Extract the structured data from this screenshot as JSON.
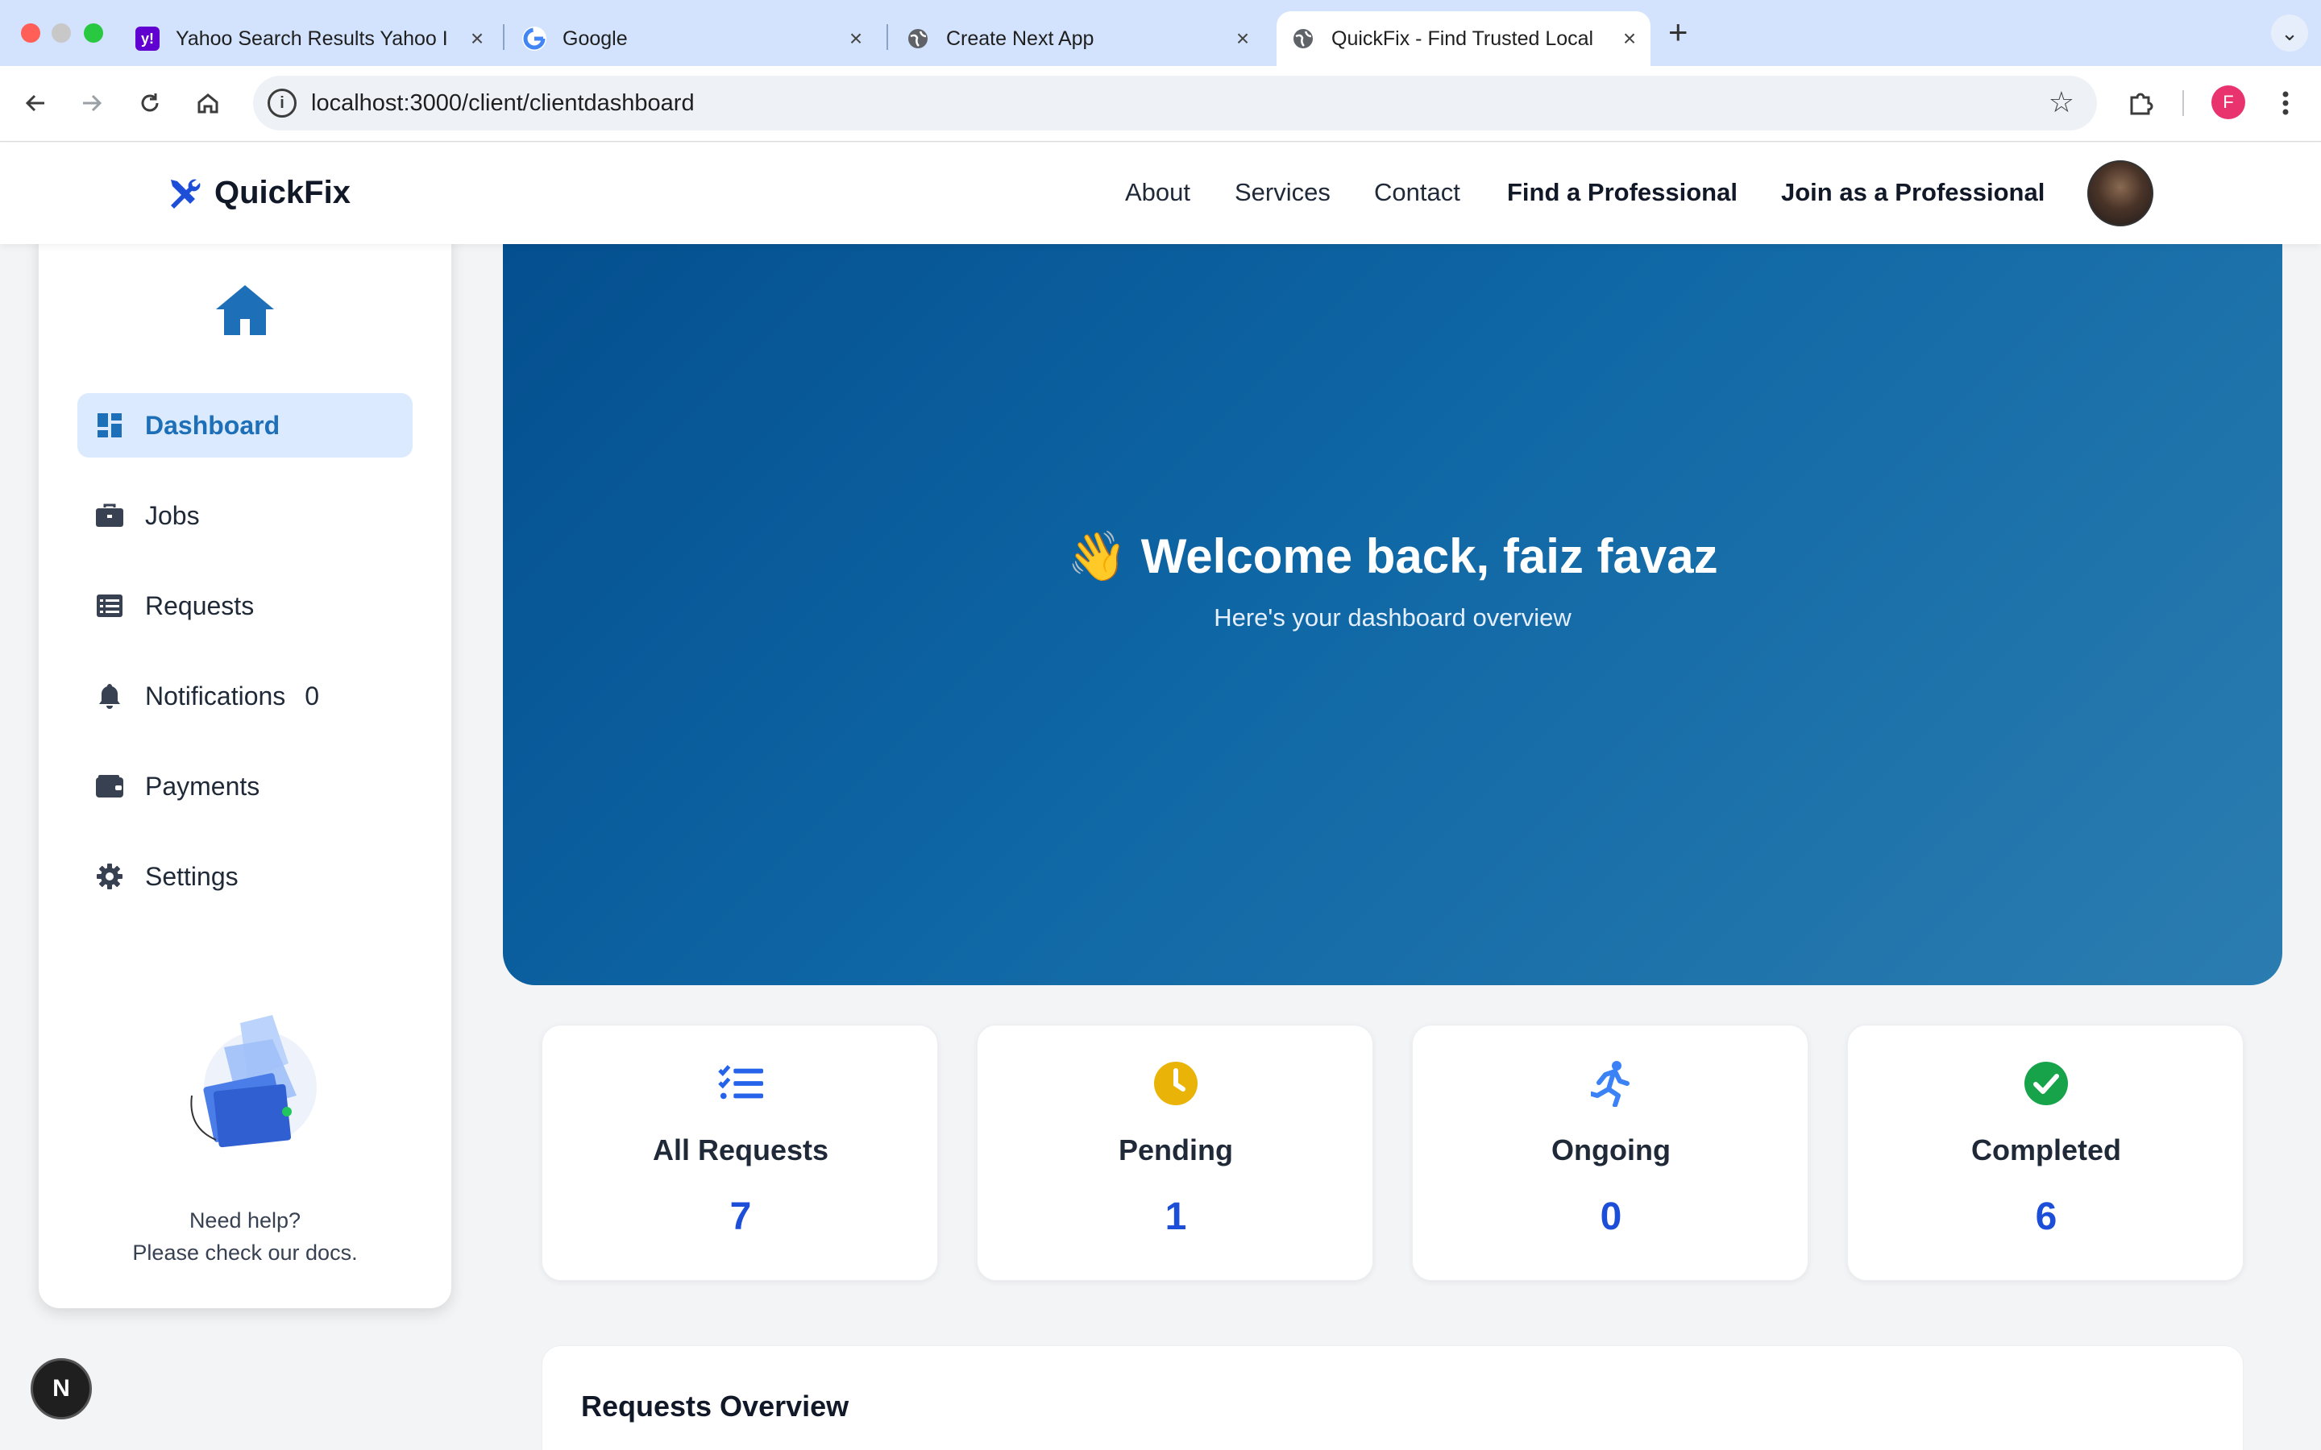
{
  "browser": {
    "tabs": [
      {
        "title": "Yahoo Search Results Yahoo I",
        "favicon": "yahoo-icon",
        "active": false
      },
      {
        "title": "Google",
        "favicon": "google-icon",
        "active": false
      },
      {
        "title": "Create Next App",
        "favicon": "globe-icon",
        "active": false
      },
      {
        "title": "QuickFix - Find Trusted Local",
        "favicon": "globe-icon",
        "active": true
      }
    ],
    "new_tab_label": "+",
    "url": "localhost:3000/client/clientdashboard",
    "profile_initial": "F"
  },
  "header": {
    "brand": "QuickFix",
    "nav": [
      {
        "label": "About",
        "strong": false
      },
      {
        "label": "Services",
        "strong": false
      },
      {
        "label": "Contact",
        "strong": false
      },
      {
        "label": "Find a Professional",
        "strong": true
      },
      {
        "label": "Join as a Professional",
        "strong": true
      }
    ]
  },
  "sidebar": {
    "items": [
      {
        "label": "Dashboard",
        "icon": "dashboard-icon",
        "active": true
      },
      {
        "label": "Jobs",
        "icon": "briefcase-icon",
        "active": false
      },
      {
        "label": "Requests",
        "icon": "list-icon",
        "active": false
      },
      {
        "label": "Notifications",
        "icon": "bell-icon",
        "active": false,
        "count": "0"
      },
      {
        "label": "Payments",
        "icon": "wallet-icon",
        "active": false
      },
      {
        "label": "Settings",
        "icon": "gear-icon",
        "active": false
      }
    ],
    "help_line1": "Need help?",
    "help_line2": "Please check our docs."
  },
  "hero": {
    "emoji": "👋",
    "title": "Welcome back, faiz favaz",
    "subtitle": "Here's your dashboard overview"
  },
  "stats": [
    {
      "label": "All Requests",
      "value": "7",
      "icon": "checklist-icon",
      "color": "#2563eb"
    },
    {
      "label": "Pending",
      "value": "1",
      "icon": "clock-icon",
      "color": "#eab308"
    },
    {
      "label": "Ongoing",
      "value": "0",
      "icon": "running-person-icon",
      "color": "#3b82f6"
    },
    {
      "label": "Completed",
      "value": "6",
      "icon": "check-circle-icon",
      "color": "#16a34a"
    }
  ],
  "overview": {
    "title": "Requests Overview"
  },
  "next_badge": "N",
  "colors": {
    "accent": "#1d6fb8",
    "stat_value": "#1d4ed8",
    "hero_start": "#044f8f",
    "hero_end": "#2b7db0"
  }
}
